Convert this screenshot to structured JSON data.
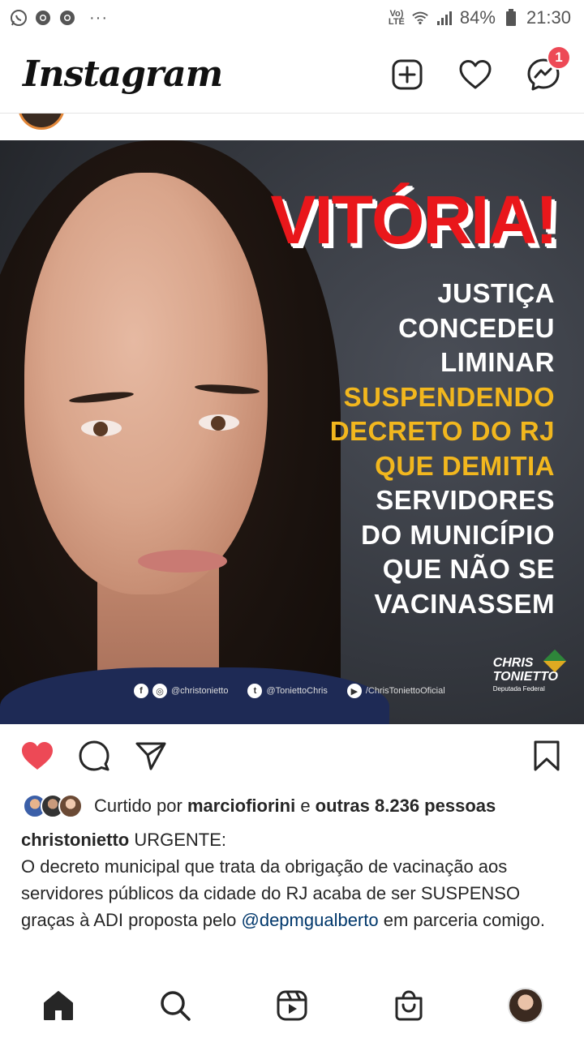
{
  "status_bar": {
    "left_icons": [
      "whatsapp-icon",
      "chrome-icon",
      "chrome-icon"
    ],
    "more": "···",
    "network": "Vo) LTE",
    "battery_percent": "84%",
    "time": "21:30"
  },
  "header": {
    "logo": "Instagram",
    "notification_count": "1"
  },
  "post": {
    "image": {
      "headline": "VITÓRIA!",
      "lines": [
        {
          "text": "JUSTIÇA",
          "color": "white"
        },
        {
          "text": "CONCEDEU",
          "color": "white"
        },
        {
          "text": "LIMINAR",
          "color": "white"
        },
        {
          "text": "SUSPENDENDO",
          "color": "yellow"
        },
        {
          "text": "DECRETO DO RJ",
          "color": "yellow"
        },
        {
          "text": "QUE DEMITIA",
          "color": "yellow"
        },
        {
          "text": "SERVIDORES",
          "color": "white"
        },
        {
          "text": "DO MUNICÍPIO",
          "color": "white"
        },
        {
          "text": "QUE NÃO SE",
          "color": "white"
        },
        {
          "text": "VACINASSEM",
          "color": "white"
        }
      ],
      "social": {
        "facebook_instagram": "@christonietto",
        "twitter": "@ToniettoChris",
        "youtube": "/ChrisToniettoOficial"
      },
      "brand": {
        "name_1": "CHRIS",
        "name_2": "TONIETTO",
        "title": "Deputada Federal"
      }
    },
    "liked": true,
    "likes": {
      "prefix": "Curtido por ",
      "user": "marciofiorini",
      "middle": " e ",
      "others": "outras 8.236 pessoas"
    },
    "caption": {
      "username": "christonietto",
      "text_1": " URGENTE:",
      "text_2": "O decreto municipal que trata da obrigação de vacinação aos servidores públicos da cidade do RJ acaba de ser SUSPENSO graças à ADI proposta pelo ",
      "mention": "@depmgualberto",
      "text_3": " em parceria comigo."
    }
  },
  "colors": {
    "like_red": "#ed4956",
    "headline_red": "#e9171b",
    "highlight_yellow": "#f2b71e",
    "mention_blue": "#00376b"
  }
}
